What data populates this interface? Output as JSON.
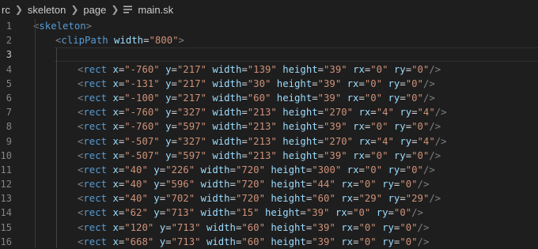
{
  "breadcrumb": {
    "items": [
      "rc",
      "skeleton",
      "page"
    ],
    "file": "main.sk"
  },
  "colors": {
    "background": "#1e1e1e",
    "tag": "#569cd6",
    "attribute": "#9cdcfe",
    "string": "#ce9178",
    "punctuation": "#808080",
    "line_number": "#858585"
  },
  "lines": [
    {
      "n": "1",
      "open": "<",
      "tag": "skeleton",
      "close": ">"
    },
    {
      "n": "2",
      "open": "<",
      "tag": "clipPath",
      "attrs": [
        {
          "name": "width",
          "value": "\"800\""
        }
      ],
      "close": ">"
    },
    {
      "n": "3"
    },
    {
      "n": "4",
      "open": "<",
      "tag": "rect",
      "attrs": [
        {
          "name": "x",
          "value": "\"-760\""
        },
        {
          "name": "y",
          "value": "\"217\""
        },
        {
          "name": "width",
          "value": "\"139\""
        },
        {
          "name": "height",
          "value": "\"39\""
        },
        {
          "name": "rx",
          "value": "\"0\""
        },
        {
          "name": "ry",
          "value": "\"0\""
        }
      ],
      "close": "/>"
    },
    {
      "n": "5",
      "open": "<",
      "tag": "rect",
      "attrs": [
        {
          "name": "x",
          "value": "\"-131\""
        },
        {
          "name": "y",
          "value": "\"217\""
        },
        {
          "name": "width",
          "value": "\"30\""
        },
        {
          "name": "height",
          "value": "\"39\""
        },
        {
          "name": "rx",
          "value": "\"0\""
        },
        {
          "name": "ry",
          "value": "\"0\""
        }
      ],
      "close": "/>"
    },
    {
      "n": "6",
      "open": "<",
      "tag": "rect",
      "attrs": [
        {
          "name": "x",
          "value": "\"-100\""
        },
        {
          "name": "y",
          "value": "\"217\""
        },
        {
          "name": "width",
          "value": "\"60\""
        },
        {
          "name": "height",
          "value": "\"39\""
        },
        {
          "name": "rx",
          "value": "\"0\""
        },
        {
          "name": "ry",
          "value": "\"0\""
        }
      ],
      "close": "/>"
    },
    {
      "n": "7",
      "open": "<",
      "tag": "rect",
      "attrs": [
        {
          "name": "x",
          "value": "\"-760\""
        },
        {
          "name": "y",
          "value": "\"327\""
        },
        {
          "name": "width",
          "value": "\"213\""
        },
        {
          "name": "height",
          "value": "\"270\""
        },
        {
          "name": "rx",
          "value": "\"4\""
        },
        {
          "name": "ry",
          "value": "\"4\""
        }
      ],
      "close": "/>"
    },
    {
      "n": "8",
      "open": "<",
      "tag": "rect",
      "attrs": [
        {
          "name": "x",
          "value": "\"-760\""
        },
        {
          "name": "y",
          "value": "\"597\""
        },
        {
          "name": "width",
          "value": "\"213\""
        },
        {
          "name": "height",
          "value": "\"39\""
        },
        {
          "name": "rx",
          "value": "\"0\""
        },
        {
          "name": "ry",
          "value": "\"0\""
        }
      ],
      "close": "/>"
    },
    {
      "n": "9",
      "open": "<",
      "tag": "rect",
      "attrs": [
        {
          "name": "x",
          "value": "\"-507\""
        },
        {
          "name": "y",
          "value": "\"327\""
        },
        {
          "name": "width",
          "value": "\"213\""
        },
        {
          "name": "height",
          "value": "\"270\""
        },
        {
          "name": "rx",
          "value": "\"4\""
        },
        {
          "name": "ry",
          "value": "\"4\""
        }
      ],
      "close": "/>"
    },
    {
      "n": "10",
      "open": "<",
      "tag": "rect",
      "attrs": [
        {
          "name": "x",
          "value": "\"-507\""
        },
        {
          "name": "y",
          "value": "\"597\""
        },
        {
          "name": "width",
          "value": "\"213\""
        },
        {
          "name": "height",
          "value": "\"39\""
        },
        {
          "name": "rx",
          "value": "\"0\""
        },
        {
          "name": "ry",
          "value": "\"0\""
        }
      ],
      "close": "/>"
    },
    {
      "n": "11",
      "open": "<",
      "tag": "rect",
      "attrs": [
        {
          "name": "x",
          "value": "\"40\""
        },
        {
          "name": "y",
          "value": "\"226\""
        },
        {
          "name": "width",
          "value": "\"720\""
        },
        {
          "name": "height",
          "value": "\"300\""
        },
        {
          "name": "rx",
          "value": "\"0\""
        },
        {
          "name": "ry",
          "value": "\"0\""
        }
      ],
      "close": "/>"
    },
    {
      "n": "12",
      "open": "<",
      "tag": "rect",
      "attrs": [
        {
          "name": "x",
          "value": "\"40\""
        },
        {
          "name": "y",
          "value": "\"596\""
        },
        {
          "name": "width",
          "value": "\"720\""
        },
        {
          "name": "height",
          "value": "\"44\""
        },
        {
          "name": "rx",
          "value": "\"0\""
        },
        {
          "name": "ry",
          "value": "\"0\""
        }
      ],
      "close": "/>"
    },
    {
      "n": "13",
      "open": "<",
      "tag": "rect",
      "attrs": [
        {
          "name": "x",
          "value": "\"40\""
        },
        {
          "name": "y",
          "value": "\"702\""
        },
        {
          "name": "width",
          "value": "\"720\""
        },
        {
          "name": "height",
          "value": "\"60\""
        },
        {
          "name": "rx",
          "value": "\"29\""
        },
        {
          "name": "ry",
          "value": "\"29\""
        }
      ],
      "close": "/>"
    },
    {
      "n": "14",
      "open": "<",
      "tag": "rect",
      "attrs": [
        {
          "name": "x",
          "value": "\"62\""
        },
        {
          "name": "y",
          "value": "\"713\""
        },
        {
          "name": "width",
          "value": "\"15\""
        },
        {
          "name": "height",
          "value": "\"39\""
        },
        {
          "name": "rx",
          "value": "\"0\""
        },
        {
          "name": "ry",
          "value": "\"0\""
        }
      ],
      "close": "/>"
    },
    {
      "n": "15",
      "open": "<",
      "tag": "rect",
      "attrs": [
        {
          "name": "x",
          "value": "\"120\""
        },
        {
          "name": "y",
          "value": "\"713\""
        },
        {
          "name": "width",
          "value": "\"60\""
        },
        {
          "name": "height",
          "value": "\"39\""
        },
        {
          "name": "rx",
          "value": "\"0\""
        },
        {
          "name": "ry",
          "value": "\"0\""
        }
      ],
      "close": "/>"
    },
    {
      "n": "16",
      "open": "<",
      "tag": "rect",
      "attrs": [
        {
          "name": "x",
          "value": "\"668\""
        },
        {
          "name": "y",
          "value": "\"713\""
        },
        {
          "name": "width",
          "value": "\"60\""
        },
        {
          "name": "height",
          "value": "\"39\""
        },
        {
          "name": "rx",
          "value": "\"0\""
        },
        {
          "name": "ry",
          "value": "\"0\""
        }
      ],
      "close": "/>"
    }
  ]
}
